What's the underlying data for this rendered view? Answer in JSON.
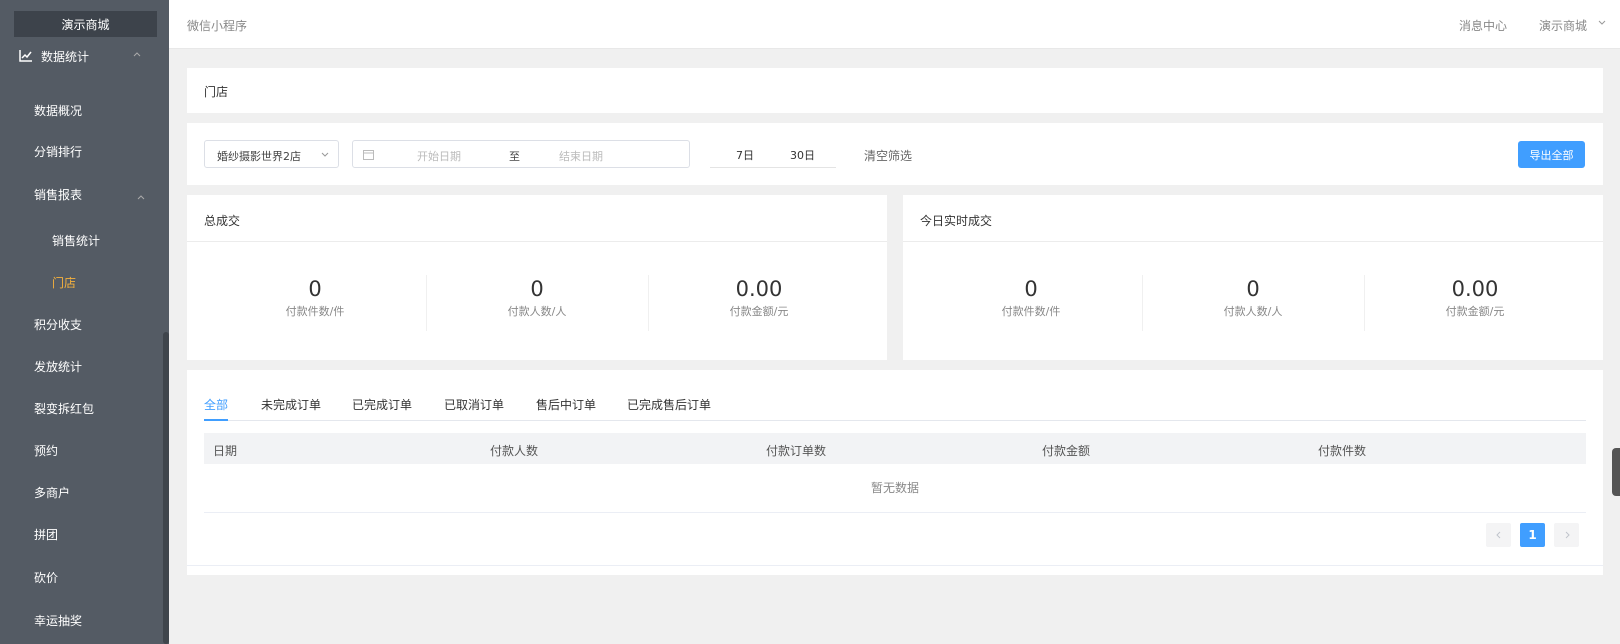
{
  "sidebar": {
    "logo": "演示商城",
    "group": "数据统计",
    "items": [
      {
        "label": "数据概况"
      },
      {
        "label": "分销排行"
      },
      {
        "label": "销售报表"
      },
      {
        "label": "销售统计"
      },
      {
        "label": "门店"
      },
      {
        "label": "积分收支"
      },
      {
        "label": "发放统计"
      },
      {
        "label": "裂变拆红包"
      },
      {
        "label": "预约"
      },
      {
        "label": "多商户"
      },
      {
        "label": "拼团"
      },
      {
        "label": "砍价"
      },
      {
        "label": "幸运抽奖"
      }
    ],
    "active_color": "#f5b13d"
  },
  "header": {
    "breadcrumb": "微信小程序",
    "message_center": "消息中心",
    "shop_name": "演示商城"
  },
  "page": {
    "title": "门店"
  },
  "filter": {
    "store_select": "婚纱摄影世界2店",
    "start_placeholder": "开始日期",
    "range_separator": "至",
    "end_placeholder": "结束日期",
    "quick_7": "7日",
    "quick_30": "30日",
    "clear": "清空筛选",
    "export": "导出全部"
  },
  "total": {
    "title": "总成交",
    "stats": [
      {
        "value": "0",
        "label": "付款件数/件"
      },
      {
        "value": "0",
        "label": "付款人数/人"
      },
      {
        "value": "0.00",
        "label": "付款金额/元"
      }
    ]
  },
  "today": {
    "title": "今日实时成交",
    "stats": [
      {
        "value": "0",
        "label": "付款件数/件"
      },
      {
        "value": "0",
        "label": "付款人数/人"
      },
      {
        "value": "0.00",
        "label": "付款金额/元"
      }
    ]
  },
  "tabs": [
    "全部",
    "未完成订单",
    "已完成订单",
    "已取消订单",
    "售后中订单",
    "已完成售后订单"
  ],
  "table": {
    "columns": [
      "日期",
      "付款人数",
      "付款订单数",
      "付款金额",
      "付款件数"
    ],
    "empty_text": "暂无数据"
  },
  "pagination": {
    "current": "1"
  },
  "colors": {
    "primary": "#409eff",
    "sidebar_bg": "#545b64"
  }
}
